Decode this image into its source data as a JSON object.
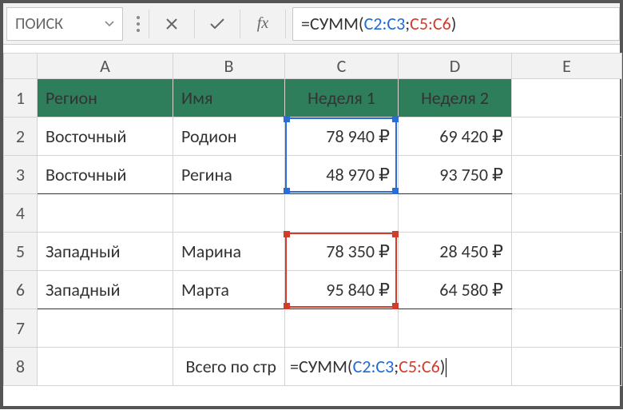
{
  "formula_bar": {
    "name_box": "ПОИСК",
    "cancel_icon": "✕",
    "accept_icon": "✓",
    "fx_label": "fx",
    "formula_prefix": "=СУММ(",
    "formula_range1": "C2:C3",
    "formula_sep": ";",
    "formula_range2": "C5:C6",
    "formula_suffix": ")"
  },
  "columns": [
    "A",
    "B",
    "C",
    "D",
    "E"
  ],
  "rows": [
    "1",
    "2",
    "3",
    "4",
    "5",
    "6",
    "7",
    "8"
  ],
  "table": {
    "header": {
      "a": "Регион",
      "b": "Имя",
      "c": "Неделя 1",
      "d": "Неделя 2"
    },
    "r2": {
      "a": "Восточный",
      "b": "Родион",
      "c": "78 940 ₽",
      "d": "69 420 ₽"
    },
    "r3": {
      "a": "Восточный",
      "b": "Регина",
      "c": "48 970 ₽",
      "d": "93 750 ₽"
    },
    "r5": {
      "a": "Западный",
      "b": "Марина",
      "c": "78 350 ₽",
      "d": "28 450 ₽"
    },
    "r6": {
      "a": "Западный",
      "b": "Марта",
      "c": "95 840 ₽",
      "d": "64 580 ₽"
    },
    "r8": {
      "b": "Всего по стр",
      "formula_fn": "=СУММ(",
      "formula_r1": "C2:C3",
      "formula_sep": ";",
      "formula_r2": "C5:C6",
      "formula_close": ")"
    }
  },
  "selection": {
    "blue_range": "C2:C3",
    "red_range": "C5:C6"
  }
}
